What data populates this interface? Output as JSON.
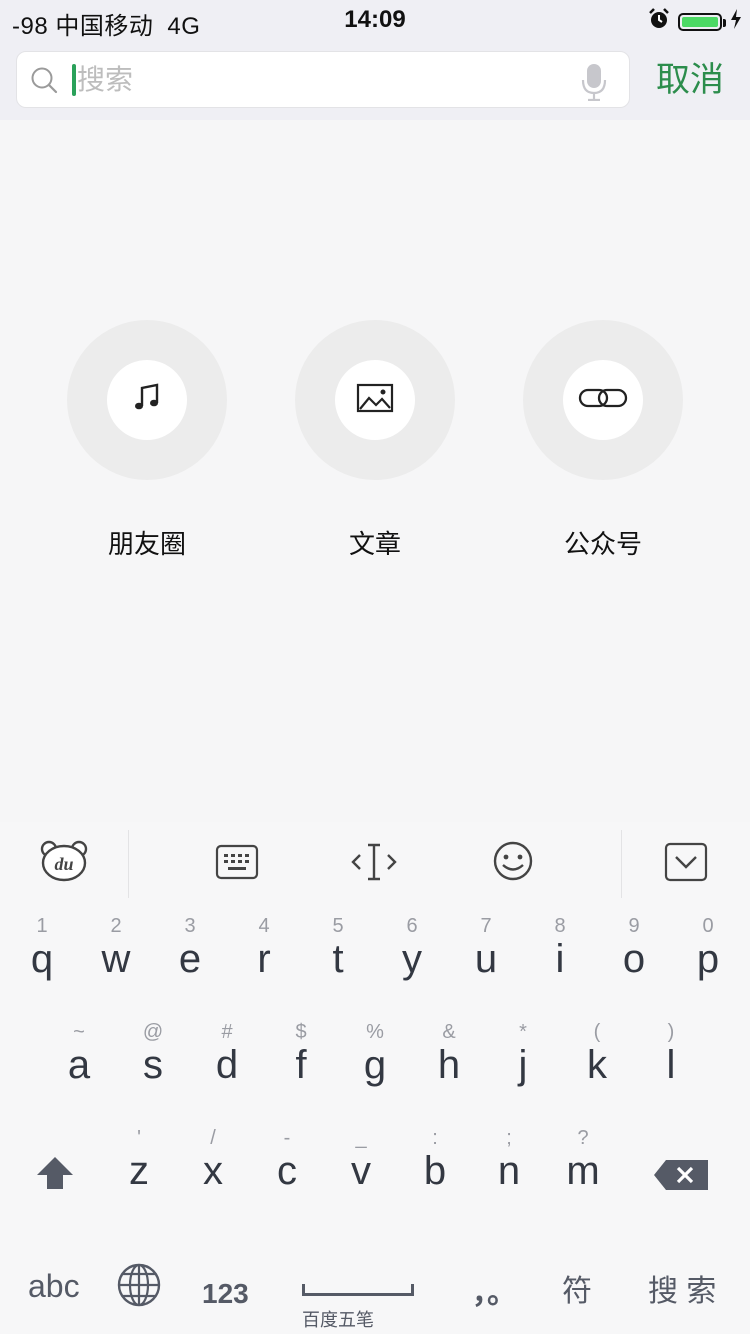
{
  "status_bar": {
    "signal": "-98",
    "carrier": "中国移动",
    "network": "4G",
    "time": "14:09",
    "battery_color": "#4cd964"
  },
  "search": {
    "placeholder": "搜索",
    "cancel_label": "取消",
    "accent_color": "#2c8d4c"
  },
  "categories": [
    {
      "label": "朋友圈",
      "icon": "music-note-icon"
    },
    {
      "label": "文章",
      "icon": "image-icon"
    },
    {
      "label": "公众号",
      "icon": "link-icon"
    }
  ],
  "keyboard": {
    "toolbar": [
      "baidu-logo-icon",
      "keyboard-icon",
      "cursor-move-icon",
      "emoji-icon",
      "collapse-keyboard-icon"
    ],
    "row1": [
      {
        "hint": "1",
        "ch": "q"
      },
      {
        "hint": "2",
        "ch": "w"
      },
      {
        "hint": "3",
        "ch": "e"
      },
      {
        "hint": "4",
        "ch": "r"
      },
      {
        "hint": "5",
        "ch": "t"
      },
      {
        "hint": "6",
        "ch": "y"
      },
      {
        "hint": "7",
        "ch": "u"
      },
      {
        "hint": "8",
        "ch": "i"
      },
      {
        "hint": "9",
        "ch": "o"
      },
      {
        "hint": "0",
        "ch": "p"
      }
    ],
    "row2": [
      {
        "hint": "~",
        "ch": "a"
      },
      {
        "hint": "@",
        "ch": "s"
      },
      {
        "hint": "#",
        "ch": "d"
      },
      {
        "hint": "$",
        "ch": "f"
      },
      {
        "hint": "%",
        "ch": "g"
      },
      {
        "hint": "&",
        "ch": "h"
      },
      {
        "hint": "*",
        "ch": "j"
      },
      {
        "hint": "(",
        "ch": "k"
      },
      {
        "hint": ")",
        "ch": "l"
      }
    ],
    "row3": [
      {
        "hint": "'",
        "ch": "z"
      },
      {
        "hint": "/",
        "ch": "x"
      },
      {
        "hint": "-",
        "ch": "c"
      },
      {
        "hint": "_",
        "ch": "v"
      },
      {
        "hint": ":",
        "ch": "b"
      },
      {
        "hint": ";",
        "ch": "n"
      },
      {
        "hint": "?",
        "ch": "m"
      }
    ],
    "bottom": {
      "abc": "abc",
      "num": "123",
      "space_label": "百度五笔",
      "punct": "，。",
      "symbols": "符",
      "search": "搜 索"
    }
  }
}
